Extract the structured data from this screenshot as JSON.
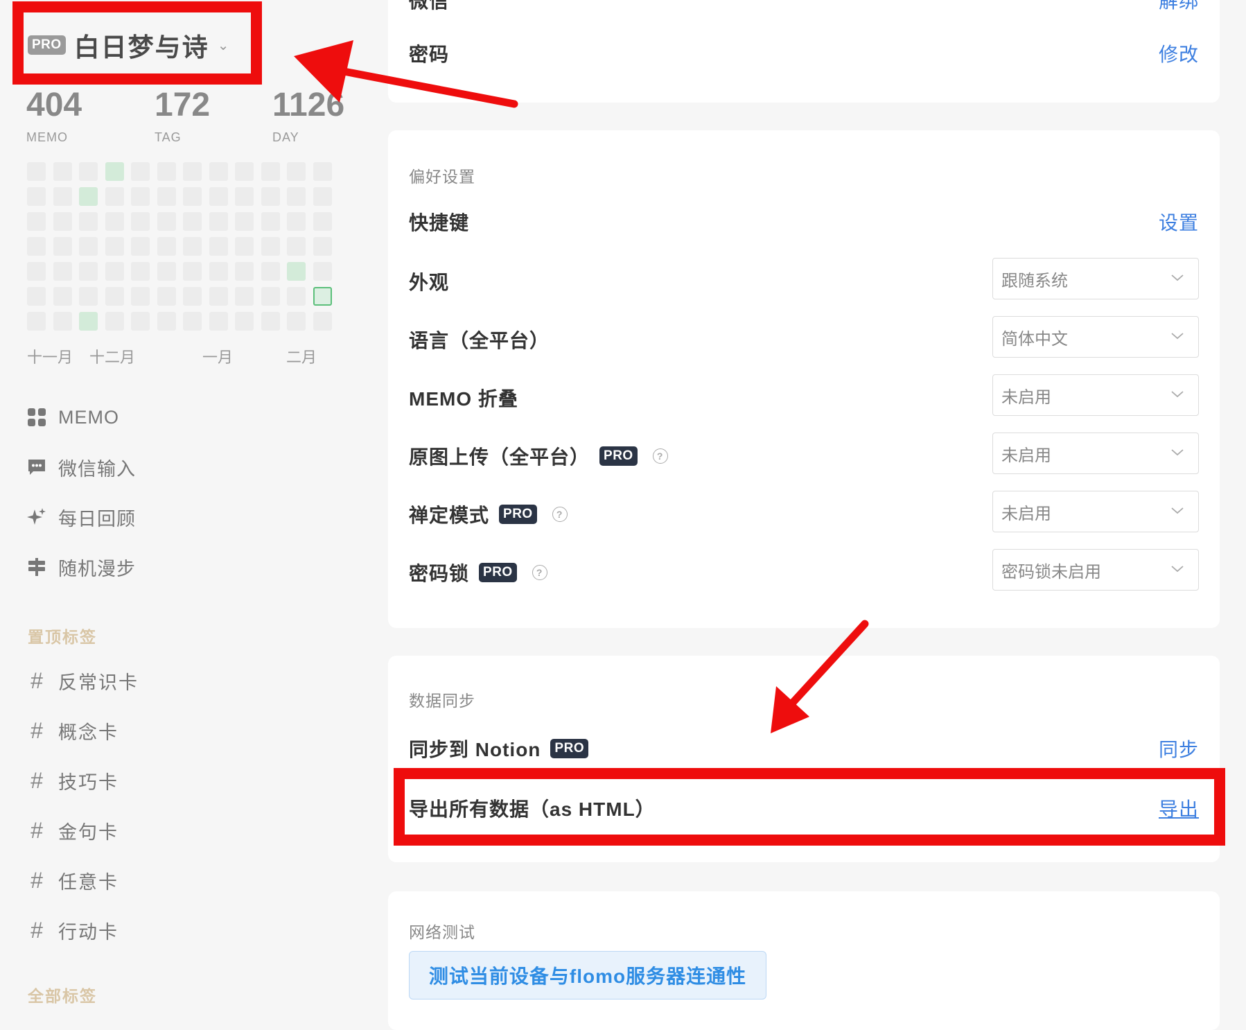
{
  "sidebar": {
    "pro_badge": "PRO",
    "username": "白日梦与诗",
    "stats": [
      {
        "value": "404",
        "label": "MEMO"
      },
      {
        "value": "172",
        "label": "TAG"
      },
      {
        "value": "1126",
        "label": "DAY"
      }
    ],
    "months": [
      "十一月",
      "十二月",
      "一月",
      "二月"
    ],
    "nav": [
      {
        "label": "MEMO",
        "icon": "grid-icon"
      },
      {
        "label": "微信输入",
        "icon": "chat-bubble-icon"
      },
      {
        "label": "每日回顾",
        "icon": "sparkle-icon"
      },
      {
        "label": "随机漫步",
        "icon": "signpost-icon"
      }
    ],
    "pinned_title": "置顶标签",
    "tags": [
      "反常识卡",
      "概念卡",
      "技巧卡",
      "金句卡",
      "任意卡",
      "行动卡"
    ],
    "all_tags_title": "全部标签"
  },
  "account": {
    "wechat_label": "微信",
    "wechat_action": "解绑",
    "password_label": "密码",
    "password_action": "修改"
  },
  "preferences": {
    "title": "偏好设置",
    "shortcut_label": "快捷键",
    "shortcut_action": "设置",
    "appearance_label": "外观",
    "appearance_value": "跟随系统",
    "language_label": "语言（全平台）",
    "language_value": "简体中文",
    "memo_fold_label": "MEMO 折叠",
    "memo_fold_value": "未启用",
    "original_upload_label": "原图上传（全平台）",
    "original_upload_value": "未启用",
    "zen_label": "禅定模式",
    "zen_value": "未启用",
    "lock_label": "密码锁",
    "lock_value": "密码锁未启用",
    "pro_badge": "PRO"
  },
  "sync": {
    "title": "数据同步",
    "notion_label": "同步到 Notion",
    "notion_action": "同步",
    "export_label": "导出所有数据（as HTML）",
    "export_action": "导出",
    "pro_badge": "PRO"
  },
  "network": {
    "title": "网络测试",
    "button_label": "测试当前设备与flomo服务器连通性"
  },
  "colors": {
    "annotation_red": "#ee0d0d",
    "link_blue": "#3d7fe0",
    "heat_green": "#d3ebd9"
  }
}
